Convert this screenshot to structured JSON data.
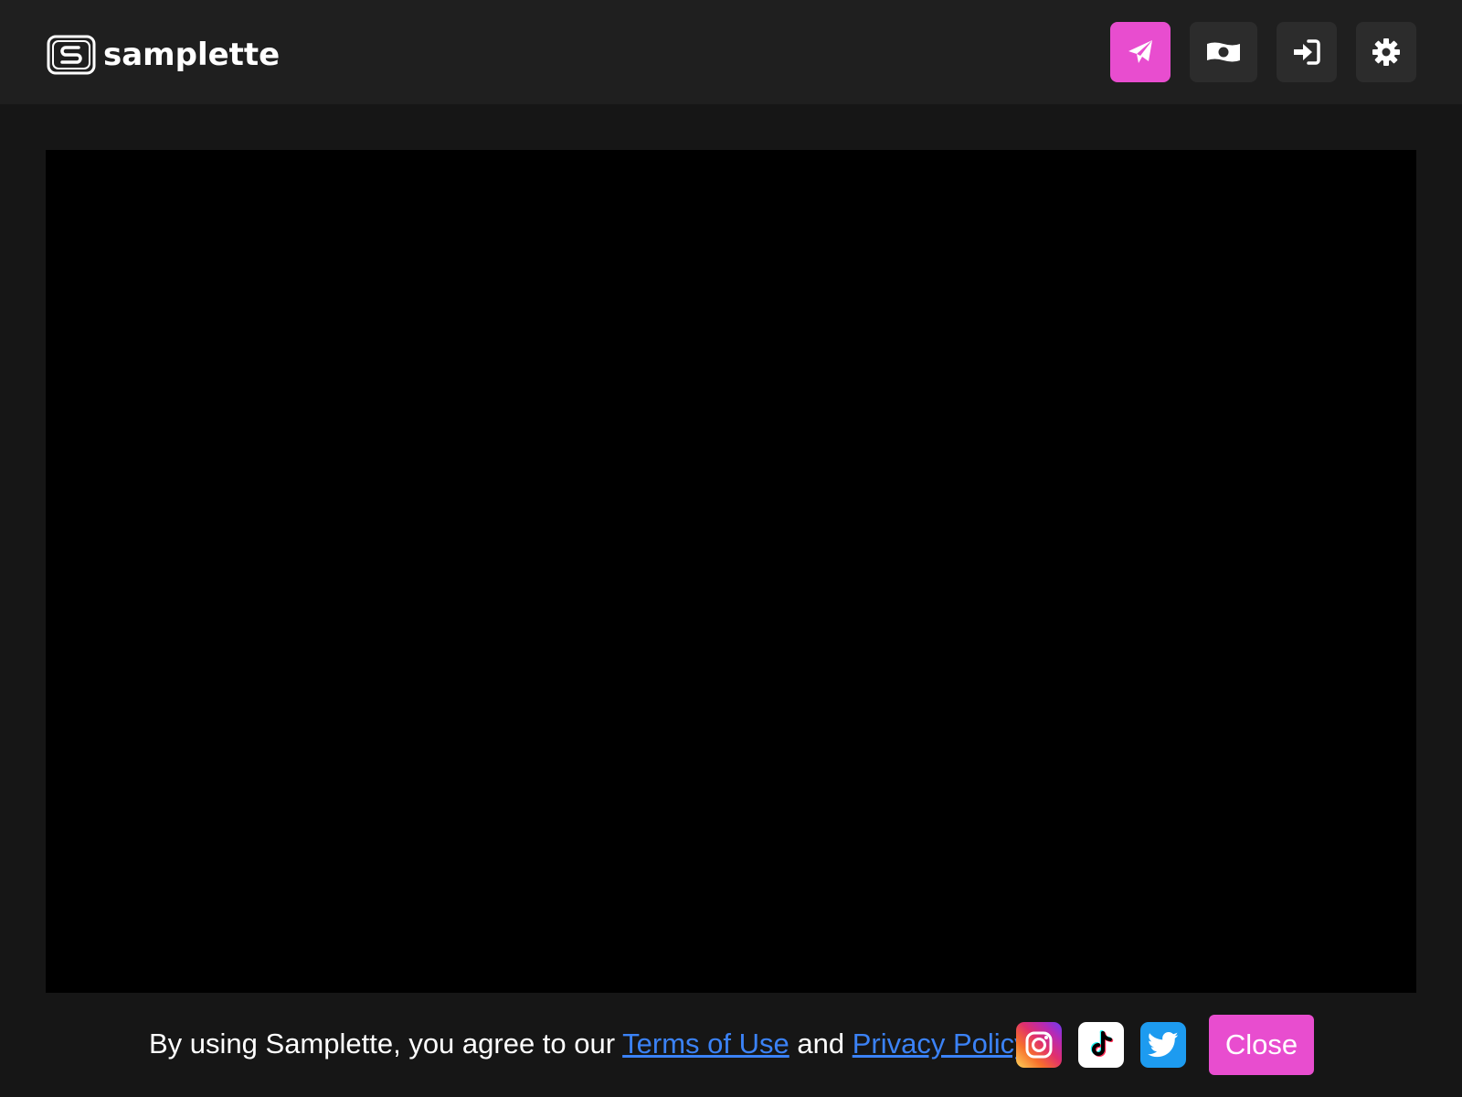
{
  "app": {
    "brand_name": "samplette"
  },
  "colors": {
    "accent": "#e84dcf",
    "header_bg": "#1f1f1f",
    "page_bg": "#161616",
    "link": "#3b82f6",
    "icon_button_bg": "#2c2c2c"
  },
  "header": {
    "buttons": [
      {
        "icon": "paper-plane-icon"
      },
      {
        "icon": "money-bill-icon"
      },
      {
        "icon": "sign-in-icon"
      },
      {
        "icon": "gear-icon"
      }
    ]
  },
  "footer": {
    "consent_prefix": "By using Samplette, you agree to our ",
    "terms_link": "Terms of Use",
    "consent_middle": " and ",
    "privacy_link": "Privacy Policy",
    "consent_suffix": ".",
    "social": [
      {
        "icon": "instagram-icon"
      },
      {
        "icon": "tiktok-icon"
      },
      {
        "icon": "twitter-icon"
      }
    ],
    "close_label": "Close"
  }
}
